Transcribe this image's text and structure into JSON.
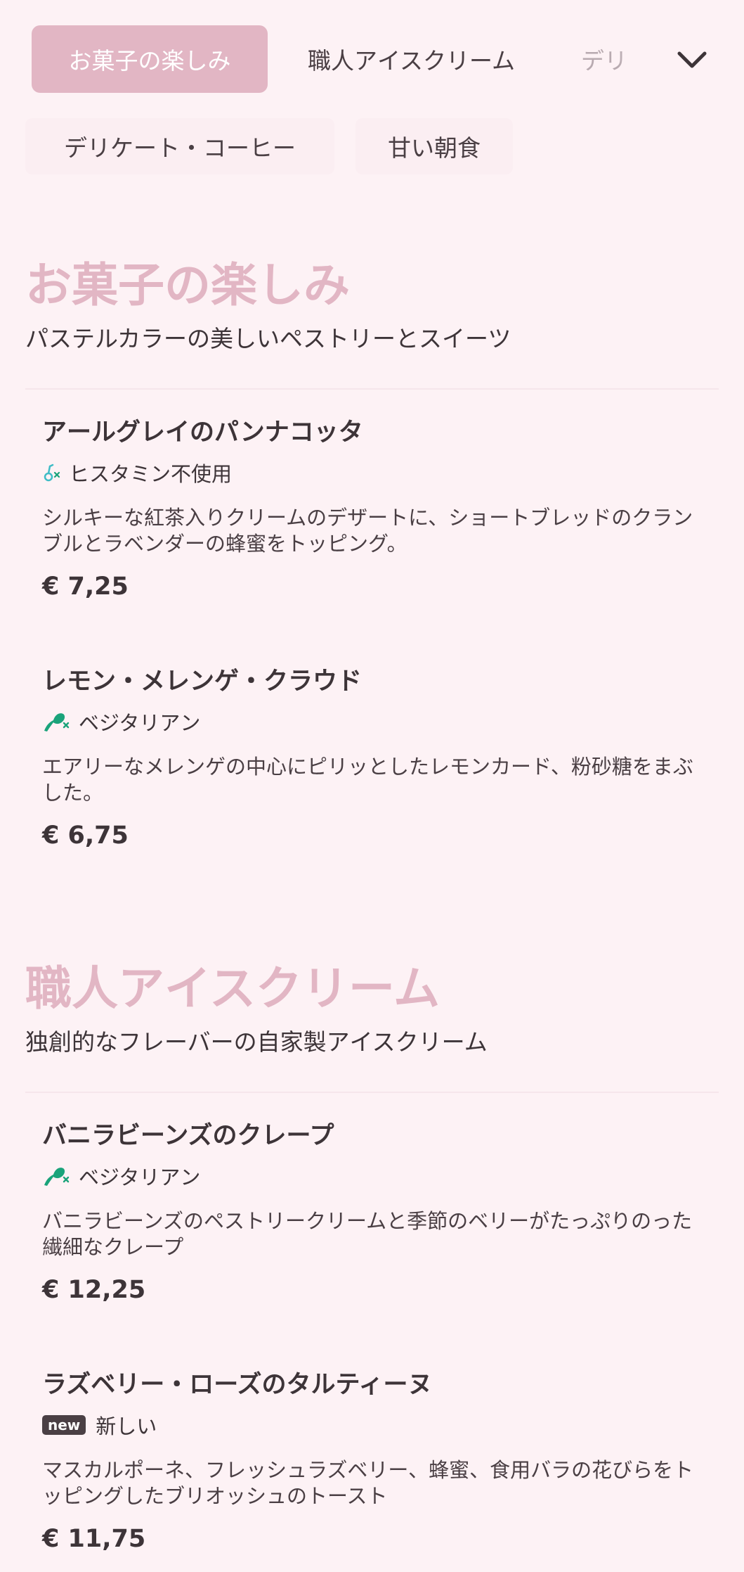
{
  "tabs": {
    "row1": [
      "お菓子の楽しみ",
      "職人アイスクリーム",
      "デリ"
    ],
    "row2": [
      "デリケート・コーヒー",
      "甘い朝食"
    ],
    "expand_icon": "chevron-down-icon"
  },
  "colors": {
    "accent": "#e2b6c4",
    "background": "#fdf2f5",
    "text": "#3d3438",
    "diet_green": "#1aa37a",
    "histamine_cyan": "#3fbcc6"
  },
  "sections": [
    {
      "title": "お菓子の楽しみ",
      "subtitle": "パステルカラーの美しいペストリーとスイーツ",
      "items": [
        {
          "name": "アールグレイのパンナコッタ",
          "tag_icon": "histamine-free-icon",
          "tag": "ヒスタミン不使用",
          "description": "シルキーな紅茶入りクリームのデザートに、ショートブレッドのクランブルとラベンダーの蜂蜜をトッピング。",
          "price": "€ 7,25"
        },
        {
          "name": "レモン・メレンゲ・クラウド",
          "tag_icon": "vegetarian-icon",
          "tag": "ベジタリアン",
          "description": "エアリーなメレンゲの中心にピリッとしたレモンカード、粉砂糖をまぶした。",
          "price": "€ 6,75"
        }
      ]
    },
    {
      "title": "職人アイスクリーム",
      "subtitle": "独創的なフレーバーの自家製アイスクリーム",
      "items": [
        {
          "name": "バニラビーンズのクレープ",
          "tag_icon": "vegetarian-icon",
          "tag": "ベジタリアン",
          "description": "バニラビーンズのペストリークリームと季節のベリーがたっぷりのった繊細なクレープ",
          "price": "€ 12,25"
        },
        {
          "name": "ラズベリー・ローズのタルティーヌ",
          "badge": "new",
          "tag": "新しい",
          "description": "マスカルポーネ、フレッシュラズベリー、蜂蜜、食用バラの花びらをトッピングしたブリオッシュのトースト",
          "price": "€ 11,75"
        }
      ]
    }
  ]
}
